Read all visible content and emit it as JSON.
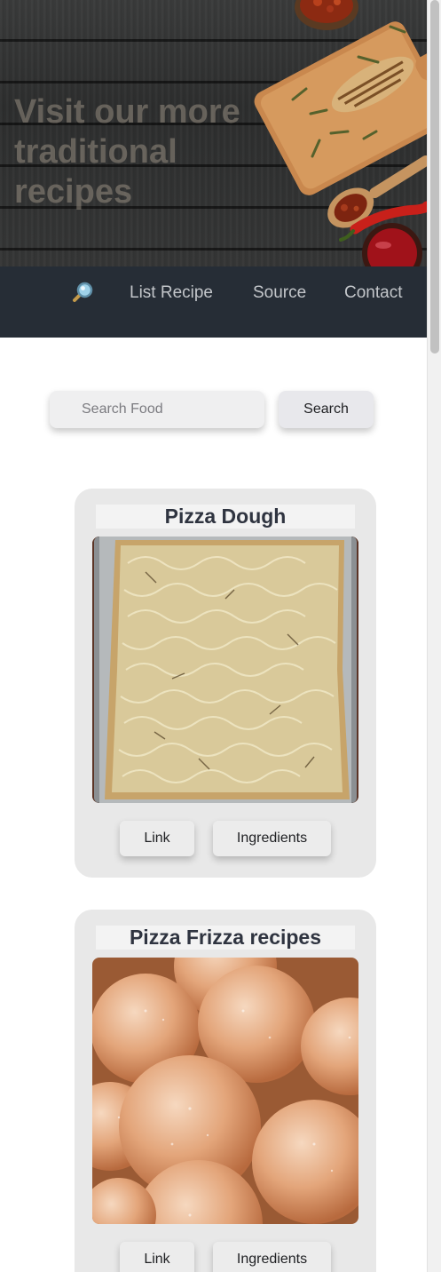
{
  "hero": {
    "title": "Visit our more traditional recipes"
  },
  "nav": {
    "search_icon": "magnifier-icon",
    "links": [
      {
        "label": "List Recipe"
      },
      {
        "label": "Source"
      },
      {
        "label": "Contact"
      }
    ]
  },
  "search": {
    "placeholder": "Search Food",
    "value": "",
    "button_label": "Search"
  },
  "recipes": [
    {
      "title": "Pizza Dough",
      "link_label": "Link",
      "ingredients_label": "Ingredients"
    },
    {
      "title": "Pizza Frizza recipes",
      "link_label": "Link",
      "ingredients_label": "Ingredients"
    }
  ],
  "colors": {
    "nav_bg": "#262d36",
    "card_bg": "#e8e8e8",
    "title_text": "#2f3440"
  }
}
